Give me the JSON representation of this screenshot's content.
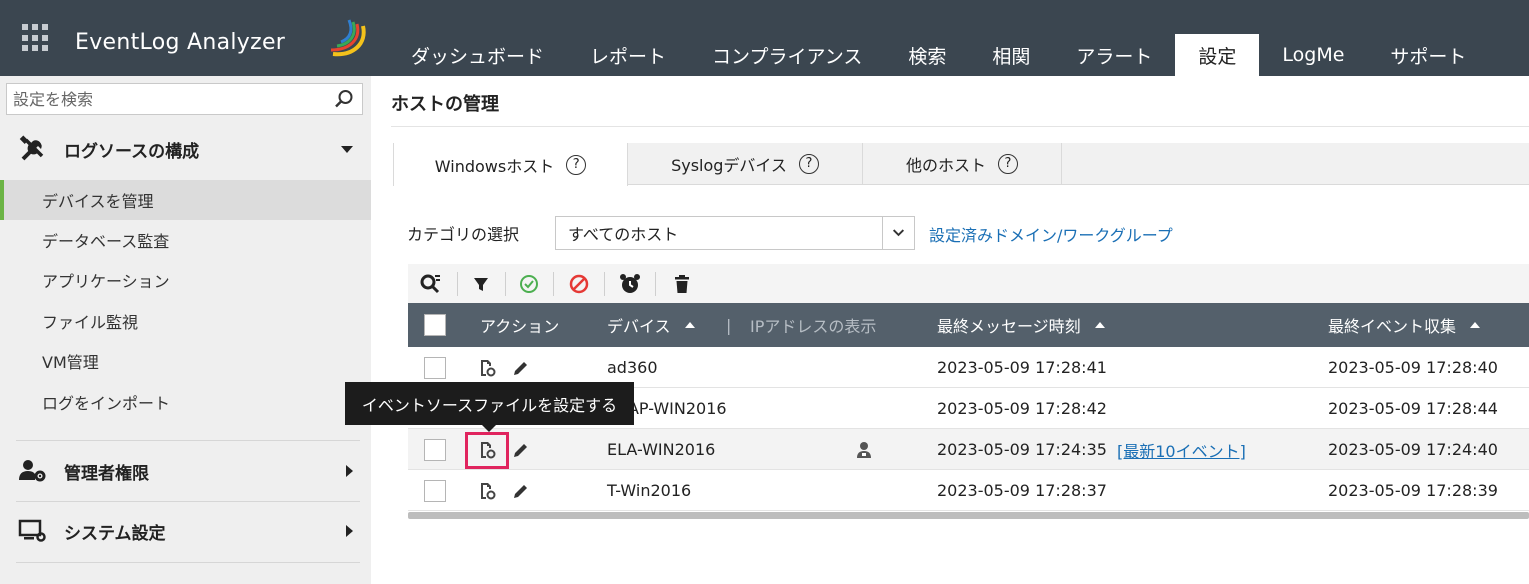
{
  "app": {
    "name": "EventLog Analyzer"
  },
  "nav": {
    "items": [
      {
        "label": "ダッシュボード"
      },
      {
        "label": "レポート"
      },
      {
        "label": "コンプライアンス"
      },
      {
        "label": "検索"
      },
      {
        "label": "相関"
      },
      {
        "label": "アラート"
      },
      {
        "label": "設定",
        "active": true
      },
      {
        "label": "LogMe"
      },
      {
        "label": "サポート"
      }
    ]
  },
  "sidebar": {
    "search_placeholder": "設定を検索",
    "sections": [
      {
        "label": "ログソースの構成",
        "icon": "tools-icon",
        "expanded": true
      },
      {
        "label": "管理者権限",
        "icon": "admin-user-gear-icon",
        "expanded": false
      },
      {
        "label": "システム設定",
        "icon": "monitor-gear-icon",
        "expanded": false
      }
    ],
    "items": [
      {
        "label": "デバイスを管理",
        "active": true
      },
      {
        "label": "データベース監査"
      },
      {
        "label": "アプリケーション"
      },
      {
        "label": "ファイル監視"
      },
      {
        "label": "VM管理"
      },
      {
        "label": "ログをインポート"
      }
    ]
  },
  "main": {
    "title": "ホストの管理",
    "tabs": [
      {
        "label": "Windowsホスト",
        "active": true
      },
      {
        "label": "Syslogデバイス"
      },
      {
        "label": "他のホスト"
      }
    ],
    "help_glyph": "?",
    "category_label": "カテゴリの選択",
    "category_value": "すべてのホスト",
    "domain_link": "設定済みドメイン/ワークグループ",
    "toolbar_icons": [
      "search-filter-icon",
      "filter-icon",
      "enable-icon",
      "disable-icon",
      "alarm-icon",
      "delete-icon"
    ],
    "table": {
      "columns": {
        "action": "アクション",
        "device": "デバイス",
        "separator": "|",
        "show_ip": "IPアドレスの表示",
        "last_message": "最終メッセージ時刻",
        "last_event": "最終イベント収集"
      },
      "rows": [
        {
          "device": "ad360",
          "last_message": "2023-05-09 17:28:41",
          "last_event": "2023-05-09 17:28:40"
        },
        {
          "device": "LDAP-WIN2016",
          "last_message": "2023-05-09 17:28:42",
          "last_event": "2023-05-09 17:28:44"
        },
        {
          "device": "ELA-WIN2016",
          "last_message": "2023-05-09 17:24:35",
          "latest_link": "[最新10イベント]",
          "last_event": "2023-05-09 17:24:40",
          "has_agent": true
        },
        {
          "device": "T-Win2016",
          "last_message": "2023-05-09 17:28:37",
          "last_event": "2023-05-09 17:28:39"
        }
      ]
    }
  },
  "tooltip": {
    "text": "イベントソースファイルを設定する"
  },
  "colors": {
    "header_bg": "#3b4650",
    "sidebar_bg": "#efefef",
    "active_accent": "#6bb445",
    "table_head_bg": "#54606b",
    "link": "#1a6fb5",
    "highlight": "#e0245e"
  }
}
